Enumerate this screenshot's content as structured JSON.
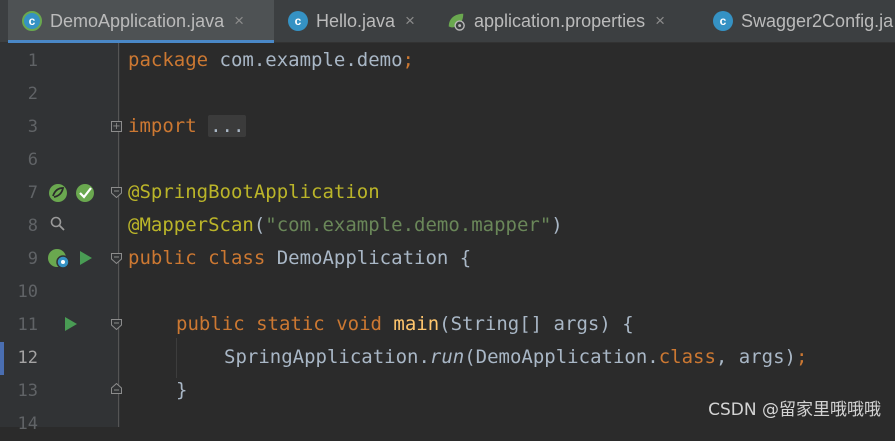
{
  "tabs": [
    {
      "label": "DemoApplication.java",
      "icon": "spring-boot-class-icon",
      "active": true,
      "close": "×"
    },
    {
      "label": "Hello.java",
      "icon": "java-class-icon",
      "close": "×"
    },
    {
      "label": "application.properties",
      "icon": "spring-properties-icon",
      "close": "×"
    },
    {
      "label": "Swagger2Config.ja",
      "icon": "java-class-icon"
    }
  ],
  "tab_icon_letter": "c",
  "line_numbers": [
    "1",
    "2",
    "3",
    "6",
    "7",
    "8",
    "9",
    "10",
    "11",
    "12",
    "13",
    "14"
  ],
  "code": {
    "l1_kw": "package",
    "l1_rest": " com.example.demo",
    "l1_semi": ";",
    "l3_kw": "import",
    "l3_fold": "...",
    "l7_ann": "@SpringBootApplication",
    "l8_ann": "@MapperScan",
    "l8_p1": "(",
    "l8_str": "\"com.example.demo.mapper\"",
    "l8_p2": ")",
    "l9_kw1": "public",
    "l9_kw2": "class",
    "l9_name": " DemoApplication {",
    "l11_kw1": "public",
    "l11_kw2": "static",
    "l11_kw3": "void",
    "l11_fn": "main",
    "l11_rest": "(String[] args) {",
    "l12_a": "SpringApplication.",
    "l12_run": "run",
    "l12_b": "(DemoApplication.",
    "l12_cls": "class",
    "l12_c": ", args)",
    "l12_semi": ";",
    "l13": "}"
  },
  "watermark": "CSDN @留家里哦哦哦",
  "colors": {
    "keyword": "#cc7832",
    "annotation": "#bbb529",
    "string": "#6a8759",
    "function": "#ffc66d",
    "text": "#a9b7c6",
    "background": "#2b2b2b"
  }
}
